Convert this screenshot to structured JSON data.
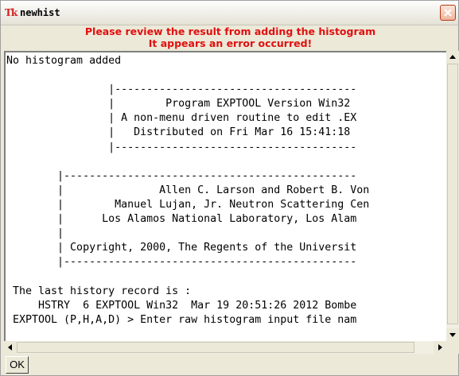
{
  "window": {
    "title": "newhist",
    "app_icon": "Tk",
    "close_icon": "close-icon"
  },
  "message": {
    "line1": "Please review the result from adding the histogram",
    "line2": "It appears an error occurred!",
    "color": "#e01010"
  },
  "output": {
    "lines": [
      "No histogram added",
      "",
      "                |--------------------------------------",
      "                |        Program EXPTOOL Version Win32",
      "                | A non-menu driven routine to edit .EX",
      "                |   Distributed on Fri Mar 16 15:41:18",
      "                |--------------------------------------",
      "",
      "        |----------------------------------------------",
      "        |               Allen C. Larson and Robert B. Von",
      "        |        Manuel Lujan, Jr. Neutron Scattering Cen",
      "        |      Los Alamos National Laboratory, Los Alam",
      "        |",
      "        | Copyright, 2000, The Regents of the Universit",
      "        |----------------------------------------------",
      "",
      " The last history record is :",
      "     HSTRY  6 EXPTOOL Win32  Mar 19 20:51:26 2012 Bombe",
      " EXPTOOL (P,H,A,D) > Enter raw histogram input file nam"
    ]
  },
  "buttons": {
    "ok_label": "OK"
  }
}
